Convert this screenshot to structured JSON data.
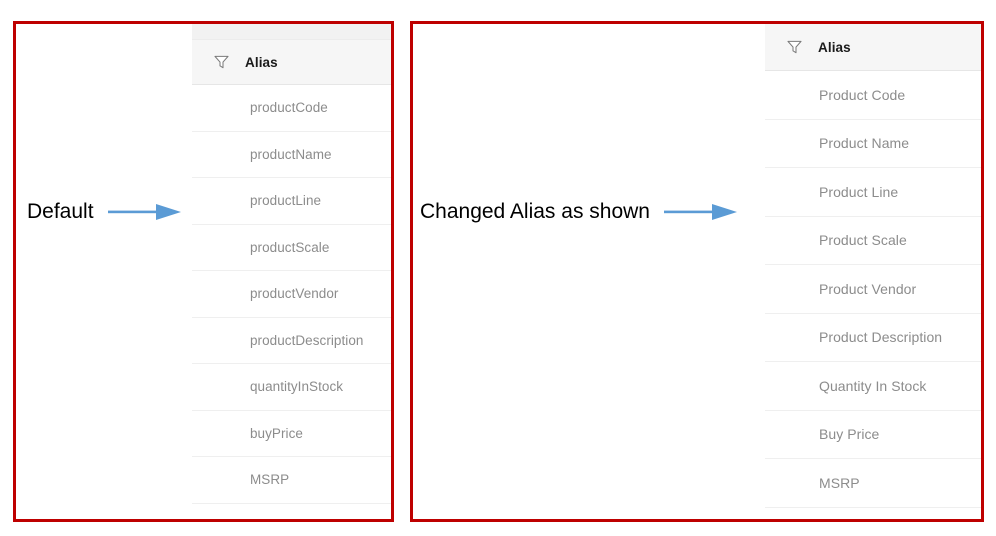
{
  "annotations": {
    "left": {
      "label": "Default",
      "arrow_icon": "right-arrow-icon",
      "arrow_color": "#5b9bd5"
    },
    "right": {
      "label": "Changed Alias as shown",
      "arrow_icon": "right-arrow-icon",
      "arrow_color": "#5b9bd5"
    }
  },
  "panels": {
    "left": {
      "border_color": "#be0000",
      "grid": {
        "filter_icon": "filter-funnel-icon",
        "column_header": "Alias",
        "rows": [
          "productCode",
          "productName",
          "productLine",
          "productScale",
          "productVendor",
          "productDescription",
          "quantityInStock",
          "buyPrice",
          "MSRP"
        ]
      }
    },
    "right": {
      "border_color": "#be0000",
      "grid": {
        "filter_icon": "filter-funnel-icon",
        "column_header": "Alias",
        "rows": [
          "Product Code",
          "Product Name",
          "Product Line",
          "Product Scale",
          "Product Vendor",
          "Product Description",
          "Quantity In Stock",
          "Buy Price",
          "MSRP"
        ]
      }
    }
  }
}
